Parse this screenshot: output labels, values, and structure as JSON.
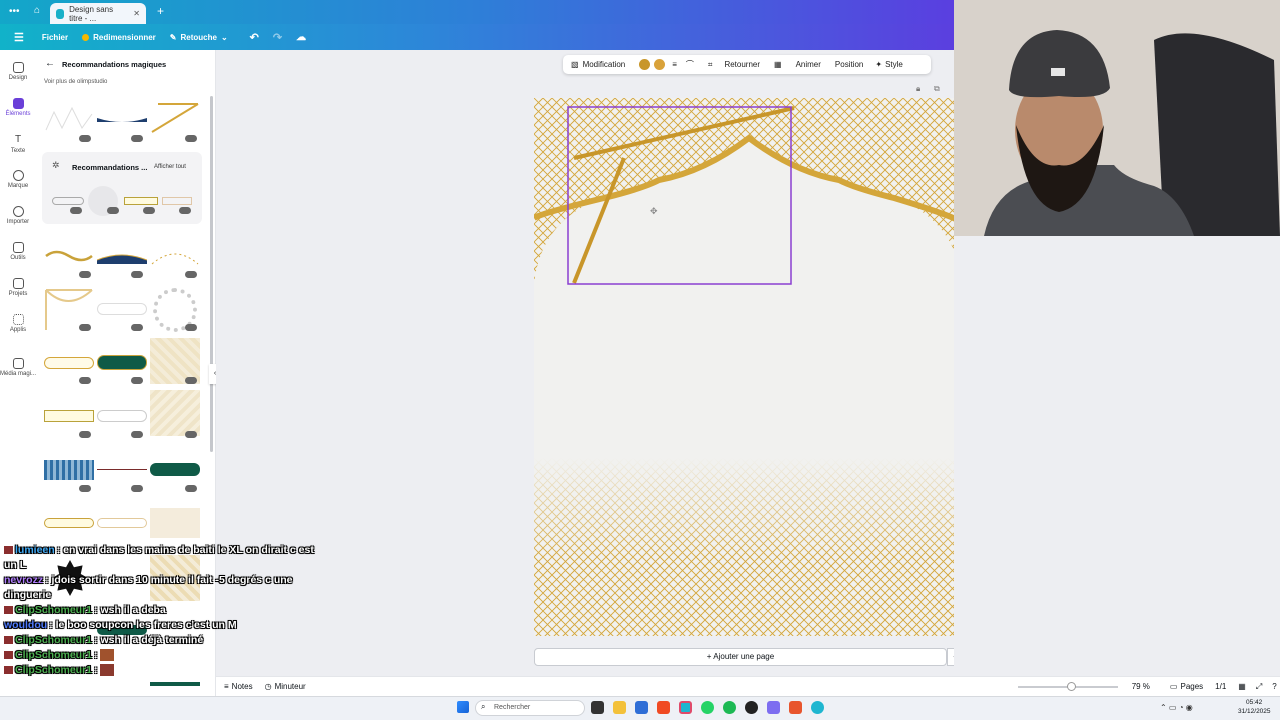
{
  "browser": {
    "tab_title": "Design sans titre - ..."
  },
  "topbar": {
    "file": "Fichier",
    "resize": "Redimensionner",
    "retouch": "Retouche"
  },
  "rail": [
    {
      "label": "Design",
      "icon": "layout-icon"
    },
    {
      "label": "Éléments",
      "icon": "shapes-icon"
    },
    {
      "label": "Texte",
      "icon": "text-icon"
    },
    {
      "label": "Marque",
      "icon": "brand-icon"
    },
    {
      "label": "Importer",
      "icon": "cloud-upload-icon"
    },
    {
      "label": "Outils",
      "icon": "pen-icon"
    },
    {
      "label": "Projets",
      "icon": "folder-icon"
    },
    {
      "label": "Applis",
      "icon": "apps-icon"
    },
    {
      "label": "Média magi...",
      "icon": "magic-media-icon"
    }
  ],
  "panel": {
    "title": "Recommandations magiques",
    "subtitle": "Voir plus de olimpstudio",
    "reco_title": "Recommandations ...",
    "reco_link": "Afficher tout"
  },
  "toolbar": {
    "modification": "Modification",
    "flip": "Retourner",
    "animate": "Animer",
    "position": "Position",
    "style": "Style",
    "colors": [
      "#c8962a",
      "#d9a23a"
    ]
  },
  "canvas": {
    "add_page": "+ Ajouter une page",
    "accent": "#8a3fd1",
    "gold": "#d4a63a"
  },
  "bottombar": {
    "notes": "Notes",
    "timer": "Minuteur",
    "zoom": "79 %",
    "pages": "Pages",
    "page_count": "1/1"
  },
  "taskbar": {
    "search": "Rechercher",
    "time": "05:42",
    "date": "31/12/2025"
  },
  "chat": [
    {
      "name": "lumieen",
      "color": "#3fa9f5",
      "text": "en vrai dans les mains de baiti le XL on dirait c est un L"
    },
    {
      "name": "nevrozz",
      "color": "#b07cff",
      "text": "jdois sortir dans 10 minute il fait -5 degrés c une dinguerie"
    },
    {
      "name": "ClipSchomeur1",
      "color": "#4caf50",
      "text": "wsh il a deba"
    },
    {
      "name": "wouldou",
      "color": "#4f7bff",
      "text": "le boo soupcon les freres c'est un M"
    },
    {
      "name": "ClipSchomeur1",
      "color": "#4caf50",
      "text": "wsh il a déjà terminé"
    },
    {
      "name": "ClipSchomeur1",
      "color": "#4caf50",
      "text": ""
    },
    {
      "name": "ClipSchomeur1",
      "color": "#4caf50",
      "text": ""
    }
  ]
}
